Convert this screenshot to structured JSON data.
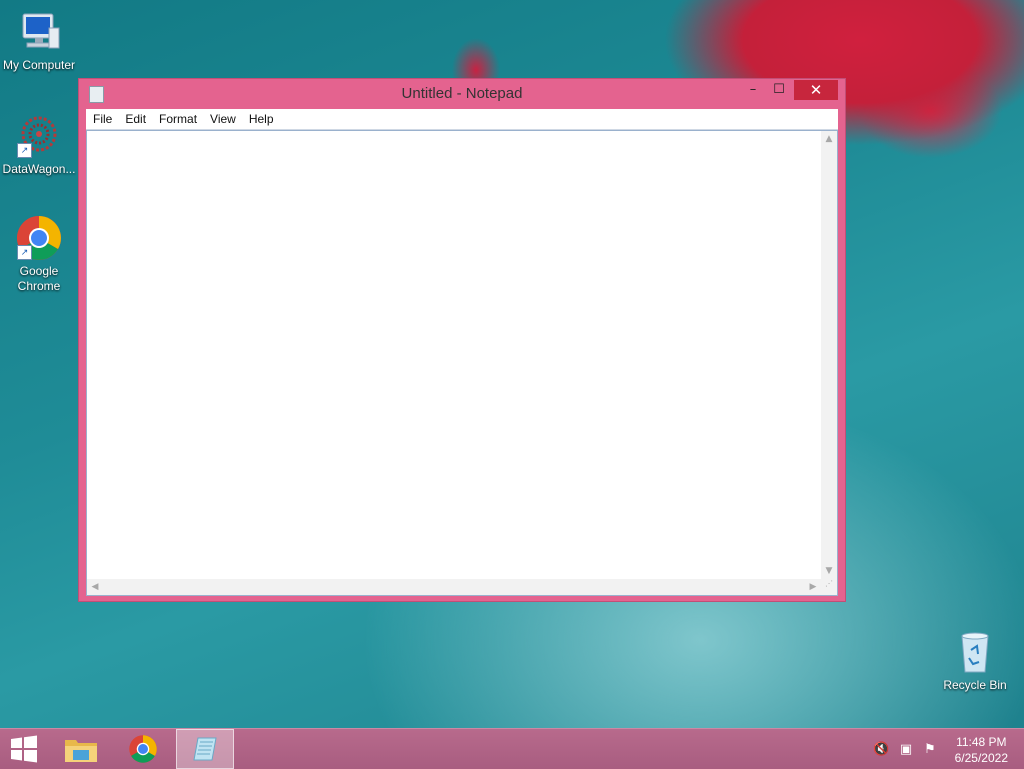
{
  "desktop": {
    "icons": [
      {
        "label": "My Computer"
      },
      {
        "label": "DataWagon..."
      },
      {
        "label": "Google Chrome"
      },
      {
        "label": "Recycle Bin"
      }
    ]
  },
  "window": {
    "title": "Untitled - Notepad",
    "controls": {
      "minimize": "–",
      "maximize": "☐",
      "close": "✕"
    },
    "menu": [
      "File",
      "Edit",
      "Format",
      "View",
      "Help"
    ],
    "editor_text": ""
  },
  "taskbar": {
    "start_icon": "windows-start-icon",
    "pinned": [
      "file-explorer-icon",
      "chrome-icon",
      "notepad-icon"
    ],
    "active": "notepad",
    "tray": [
      "volume-muted-icon",
      "network-icon",
      "action-center-flag-icon"
    ],
    "clock": {
      "time": "11:48 PM",
      "date": "6/25/2022"
    }
  },
  "colors": {
    "window_frame": "#e4638f",
    "close_button": "#c7263d",
    "taskbar": "#b06284"
  }
}
